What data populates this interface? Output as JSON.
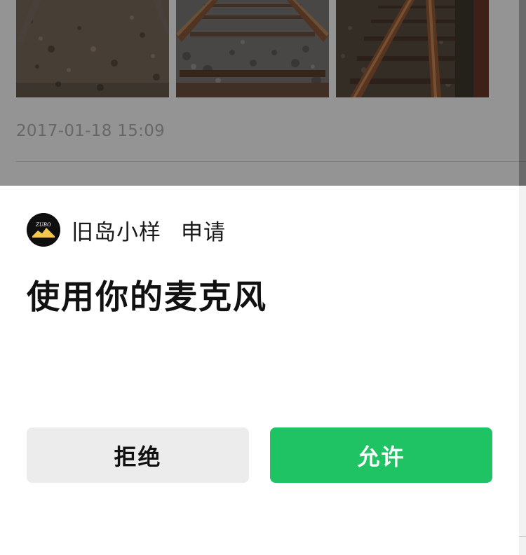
{
  "post": {
    "photos": [
      "rail-track-photo",
      "rail-track-photo",
      "rail-track-photo"
    ],
    "timestamp": "2017-01-18 15:09"
  },
  "sheet": {
    "app_logo_text": "ZUBO",
    "app_name": "旧岛小样",
    "request_label": "申请",
    "permission_title": "使用你的麦克风",
    "deny_label": "拒绝",
    "allow_label": "允许"
  },
  "colors": {
    "allow_button": "#1fc363",
    "deny_button": "#ececec",
    "overlay": "rgba(0,0,0,0.42)"
  }
}
